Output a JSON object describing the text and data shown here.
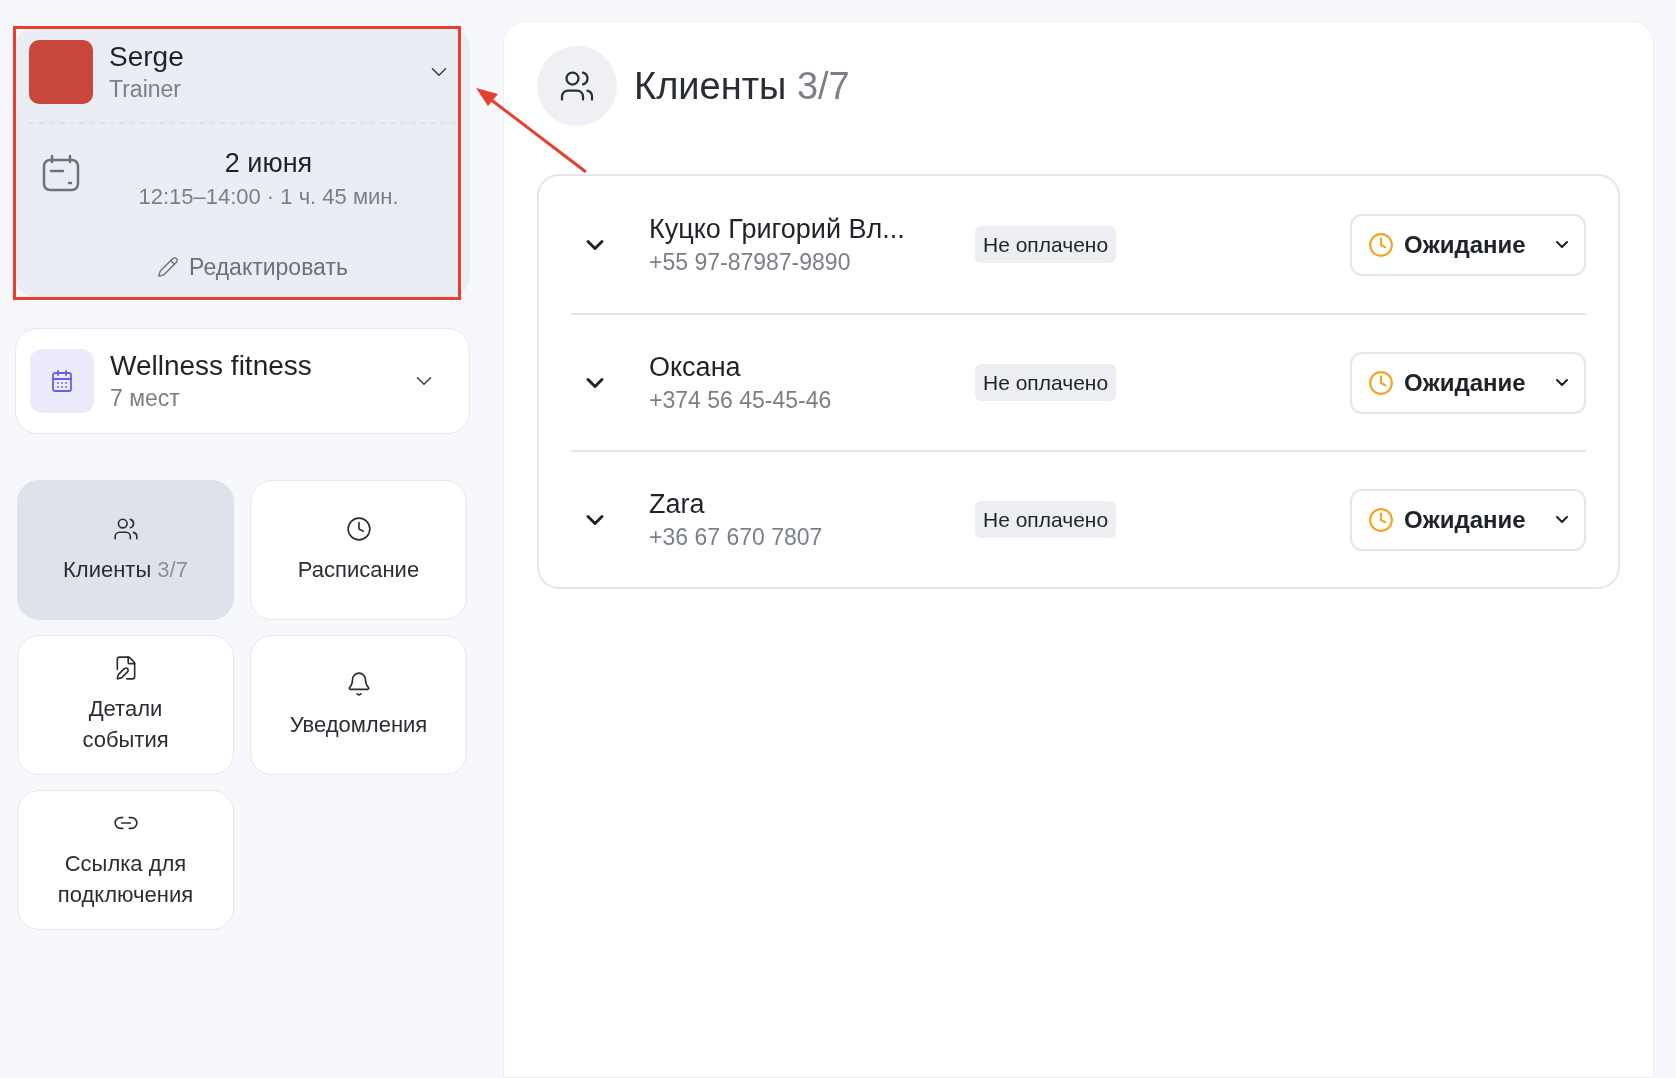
{
  "trainer": {
    "name": "Serge",
    "role": "Trainer",
    "date": "2 июня",
    "time": "12:15–14:00 · 1 ч. 45 мин.",
    "edit": "Редактировать"
  },
  "location": {
    "name": "Wellness fitness",
    "capacity": "7 мест"
  },
  "nav": [
    {
      "kind": "clients",
      "label": "Клиенты",
      "count": "3/7",
      "selected": true
    },
    {
      "kind": "schedule",
      "label": "Расписание",
      "selected": false
    },
    {
      "kind": "details",
      "label": "Детали события",
      "selected": false
    },
    {
      "kind": "notifications",
      "label": "Уведомления",
      "selected": false
    },
    {
      "kind": "link",
      "label": "Ссылка для подключения",
      "selected": false
    }
  ],
  "header": {
    "title": "Клиенты",
    "count": "3/7"
  },
  "clients": [
    {
      "name": "Куцко Григорий Вл...",
      "phone": "+55 97-87987-9890",
      "payment": "Не оплачено",
      "status": "Ожидание"
    },
    {
      "name": "Оксана",
      "phone": "+374 56 45-45-46",
      "payment": "Не оплачено",
      "status": "Ожидание"
    },
    {
      "name": "Zara",
      "phone": "+36 67 670 7807",
      "payment": "Не оплачено",
      "status": "Ожидание"
    }
  ]
}
